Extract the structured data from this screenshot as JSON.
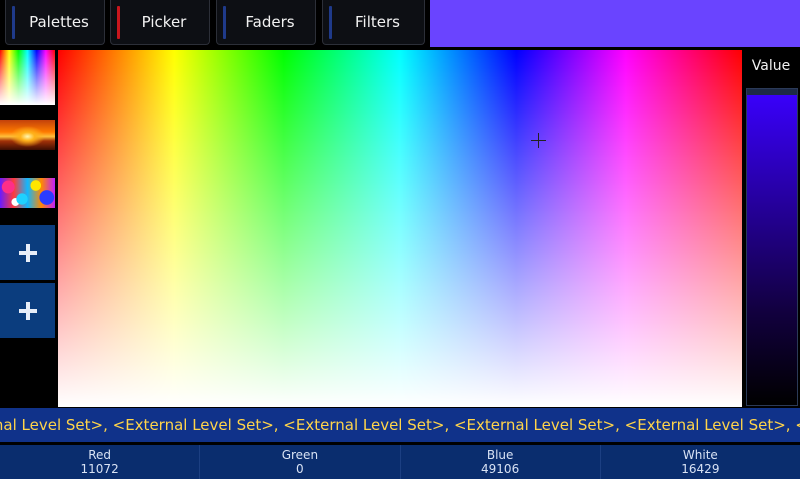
{
  "tabs": [
    {
      "label": "Palettes",
      "active": false
    },
    {
      "label": "Picker",
      "active": true
    },
    {
      "label": "Faders",
      "active": false
    },
    {
      "label": "Filters",
      "active": false
    }
  ],
  "current_color_hex": "#6a44ff",
  "palettes": {
    "thumbnails": [
      "spectrum-palette",
      "sunset-palette",
      "paint-splash-palette"
    ],
    "add_buttons": 2
  },
  "value_slider": {
    "label": "Value"
  },
  "ticker": {
    "text": "rnal Level Set>, <External Level Set>, <External Level Set>, <External Level Set>, <External Level Set>, <External Level Set>,"
  },
  "channels": [
    {
      "name": "Red",
      "value": "11072"
    },
    {
      "name": "Green",
      "value": "0"
    },
    {
      "name": "Blue",
      "value": "49106"
    },
    {
      "name": "White",
      "value": "16429"
    }
  ],
  "colors": {
    "accent_active": "#c8161d",
    "accent_inactive": "#1f3a8a",
    "ticker_text": "#ffd44a",
    "ticker_bg": "#10328a",
    "channel_bg": "#0a2d6e",
    "add_button_bg": "#0b3d7e"
  }
}
